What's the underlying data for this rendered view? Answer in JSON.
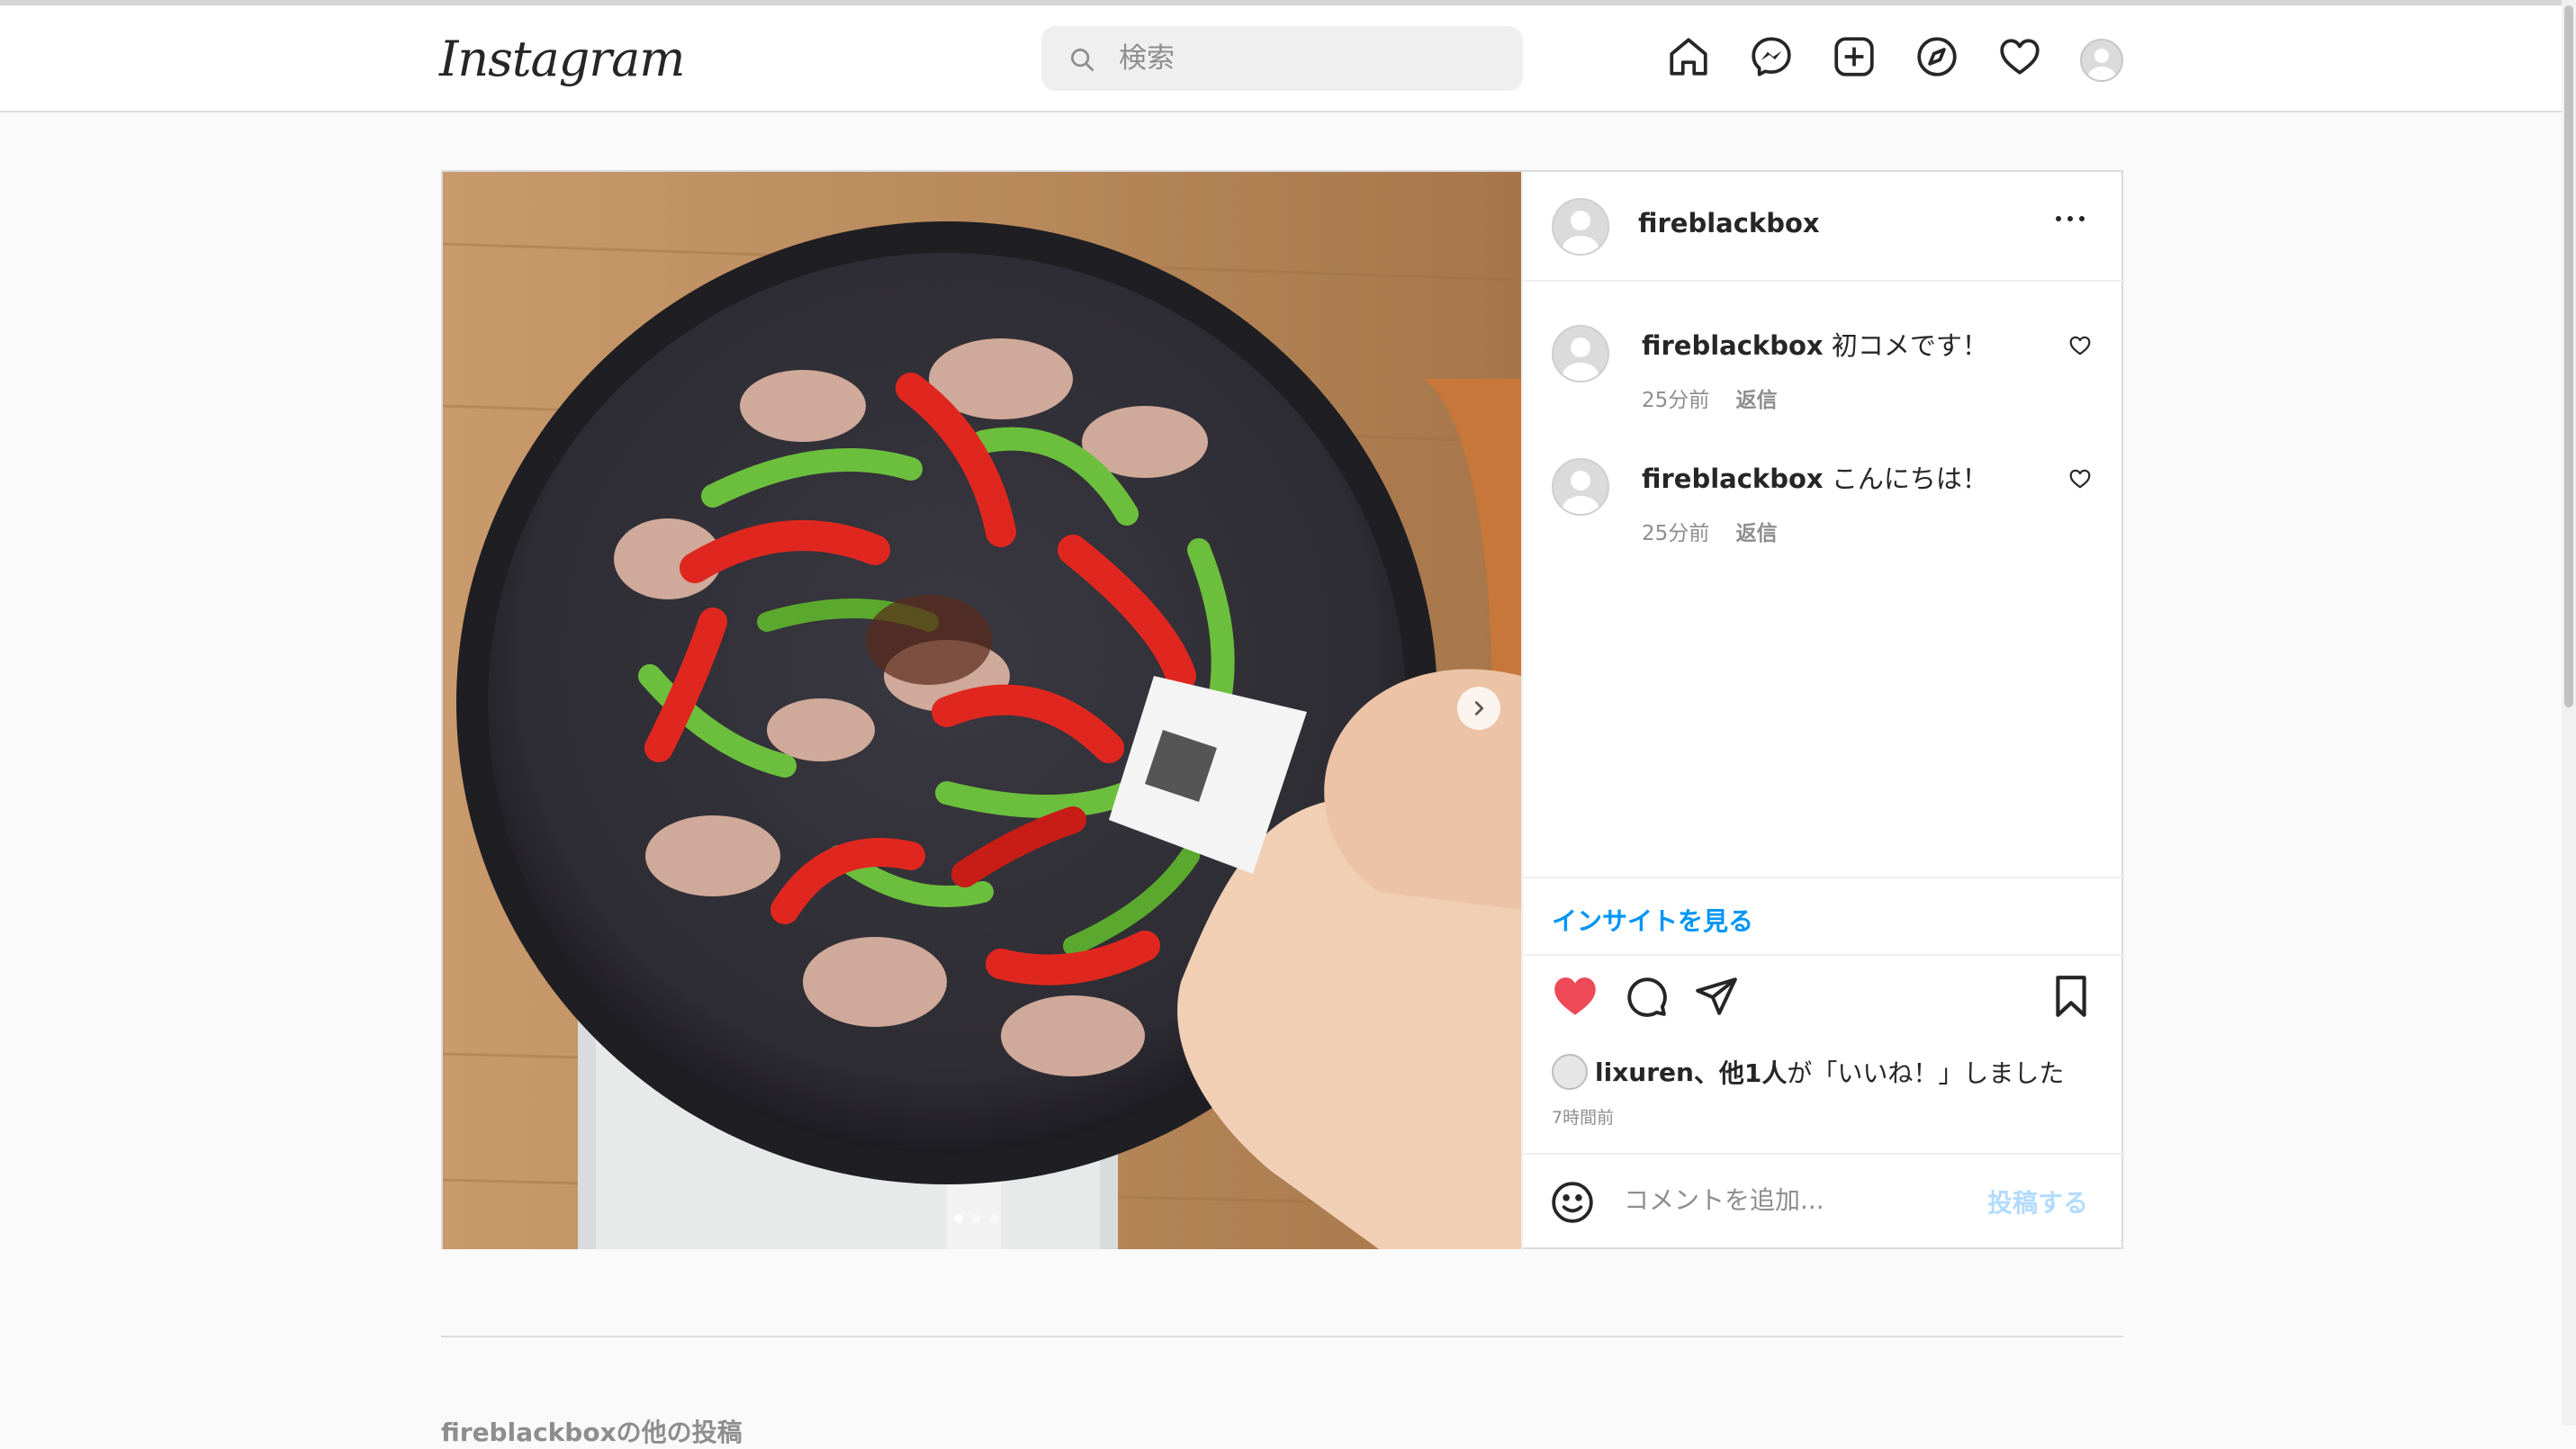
{
  "app": {
    "logo": "Instagram"
  },
  "search": {
    "placeholder": "検索"
  },
  "post": {
    "author": "fireblackbox",
    "comments": [
      {
        "user": "fireblackbox",
        "text": "初コメです！",
        "time": "25分前",
        "reply": "返信"
      },
      {
        "user": "fireblackbox",
        "text": "こんにちは！",
        "time": "25分前",
        "reply": "返信"
      }
    ],
    "insights_label": "インサイトを見る",
    "likes": {
      "user": "lixuren",
      "rest": "、他1人",
      "suffix": "が「いいね！」しました"
    },
    "time": "7時間前",
    "add_comment_placeholder": "コメントを追加...",
    "post_button": "投稿する",
    "carousel": {
      "current": 1,
      "total": 3
    }
  },
  "footer": {
    "more_posts": "fireblackboxの他の投稿"
  },
  "colors": {
    "like_red": "#ed4956",
    "link_blue": "#0095f6",
    "post_disabled": "#b3dbff"
  }
}
